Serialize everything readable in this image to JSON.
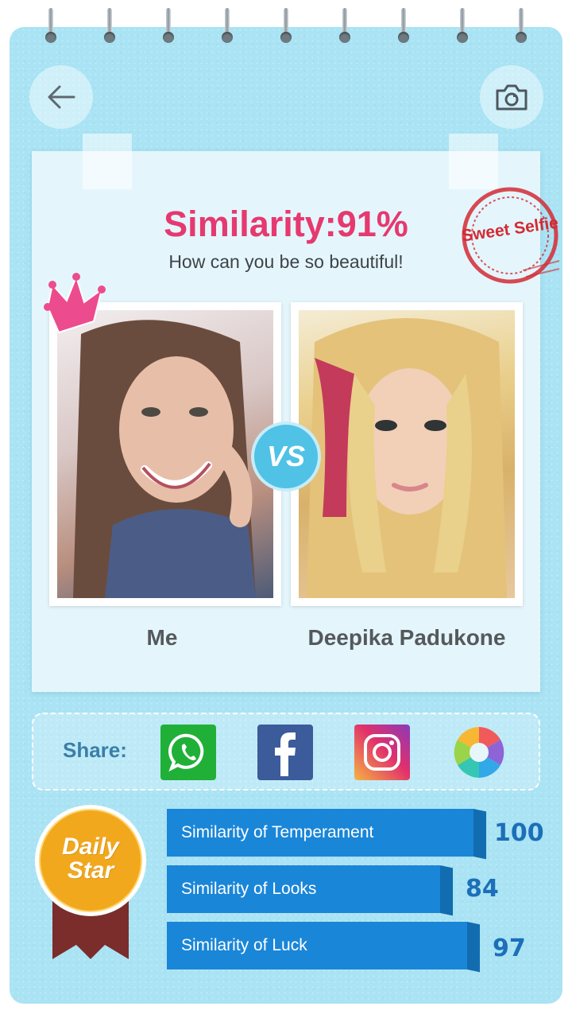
{
  "header": {
    "back_icon": "arrow-left-icon",
    "camera_icon": "camera-icon"
  },
  "result": {
    "title": "Similarity:91%",
    "subtitle": "How can you be so beautiful!",
    "stamp": "Sweet Selfie",
    "vs": "VS",
    "me_name": "Me",
    "celebrity_name": "Deepika Padukone"
  },
  "share": {
    "label": "Share:",
    "apps": [
      "whatsapp-icon",
      "facebook-icon",
      "instagram-icon",
      "aperture-icon"
    ]
  },
  "badge": {
    "line1": "Daily",
    "line2": "Star"
  },
  "stats": [
    {
      "label": "Similarity of Temperament",
      "value": "100"
    },
    {
      "label": "Similarity of Looks",
      "value": "84"
    },
    {
      "label": "Similarity of Luck",
      "value": "97"
    }
  ],
  "colors": {
    "background": "#a9e3f4",
    "accent_pink": "#e6396f",
    "bar_blue": "#1a86d8",
    "score_blue": "#1c6fb8",
    "badge_yellow": "#f2a81d"
  }
}
